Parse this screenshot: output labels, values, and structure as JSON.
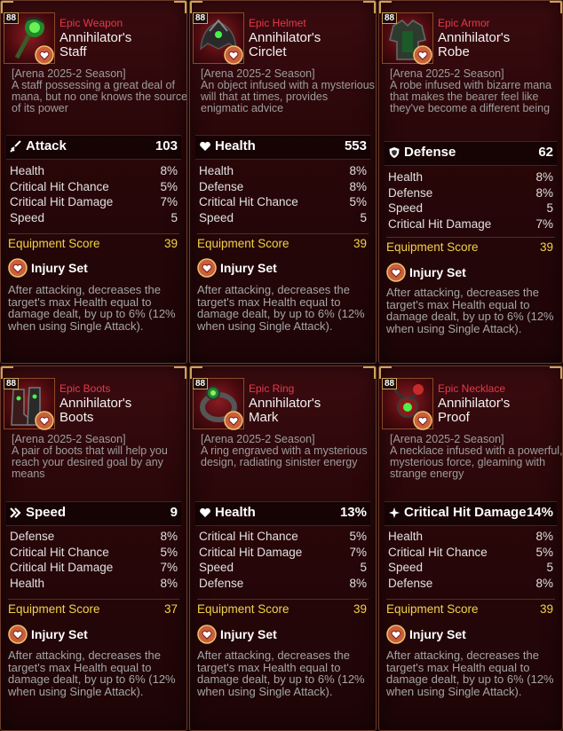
{
  "colors": {
    "rarity": "#e8384b",
    "score": "#f2d24a",
    "frame": "#c9a45a"
  },
  "items": [
    {
      "level": "88",
      "rarity": "Epic Weapon",
      "name_line1": "Annihilator's",
      "name_line2": "Staff",
      "icon": "staff-icon",
      "season": "[Arena 2025-2 Season]",
      "desc": "A staff possessing a great deal of mana, but no one knows the source of its power",
      "main": {
        "icon": "sword-icon",
        "label": "Attack",
        "value": "103"
      },
      "subs": [
        {
          "label": "Health",
          "value": "8%"
        },
        {
          "label": "Critical Hit Chance",
          "value": "5%"
        },
        {
          "label": "Critical Hit Damage",
          "value": "7%"
        },
        {
          "label": "Speed",
          "value": "5"
        }
      ],
      "score_label": "Equipment Score",
      "score": "39",
      "set_name": "Injury Set",
      "set_desc": "After attacking, decreases the target's max Health equal to damage dealt, by up to 6% (12% when using Single Attack)."
    },
    {
      "level": "88",
      "rarity": "Epic Helmet",
      "name_line1": "Annihilator's",
      "name_line2": "Circlet",
      "icon": "helmet-icon",
      "season": "[Arena 2025-2 Season]",
      "desc": "An object infused with a mysterious will that at times, provides enigmatic advice",
      "main": {
        "icon": "heart-icon",
        "label": "Health",
        "value": "553"
      },
      "subs": [
        {
          "label": "Health",
          "value": "8%"
        },
        {
          "label": "Defense",
          "value": "8%"
        },
        {
          "label": "Critical Hit Chance",
          "value": "5%"
        },
        {
          "label": "Speed",
          "value": "5"
        }
      ],
      "score_label": "Equipment Score",
      "score": "39",
      "set_name": "Injury Set",
      "set_desc": "After attacking, decreases the target's max Health equal to damage dealt, by up to 6% (12% when using Single Attack)."
    },
    {
      "level": "88",
      "rarity": "Epic Armor",
      "name_line1": "Annihilator's",
      "name_line2": "Robe",
      "icon": "armor-icon",
      "season": "[Arena 2025-2 Season]",
      "desc": "A robe infused with bizarre mana that makes the bearer feel like they've become a different being",
      "main": {
        "icon": "shield-icon",
        "label": "Defense",
        "value": "62"
      },
      "subs": [
        {
          "label": "Health",
          "value": "8%"
        },
        {
          "label": "Defense",
          "value": "8%"
        },
        {
          "label": "Speed",
          "value": "5"
        },
        {
          "label": "Critical Hit Damage",
          "value": "7%"
        }
      ],
      "score_label": "Equipment Score",
      "score": "39",
      "set_name": "Injury Set",
      "set_desc": "After attacking, decreases the target's max Health equal to damage dealt, by up to 6% (12% when using Single Attack)."
    },
    {
      "level": "88",
      "rarity": "Epic Boots",
      "name_line1": "Annihilator's",
      "name_line2": "Boots",
      "icon": "boots-icon",
      "season": "[Arena 2025-2 Season]",
      "desc": "A pair of boots that will help you reach your desired goal by any means",
      "main": {
        "icon": "speed-icon",
        "label": "Speed",
        "value": "9"
      },
      "subs": [
        {
          "label": "Defense",
          "value": "8%"
        },
        {
          "label": "Critical Hit Chance",
          "value": "5%"
        },
        {
          "label": "Critical Hit Damage",
          "value": "7%"
        },
        {
          "label": "Health",
          "value": "8%"
        }
      ],
      "score_label": "Equipment Score",
      "score": "37",
      "set_name": "Injury Set",
      "set_desc": "After attacking, decreases the target's max Health equal to damage dealt, by up to 6% (12% when using Single Attack)."
    },
    {
      "level": "88",
      "rarity": "Epic Ring",
      "name_line1": "Annihilator's",
      "name_line2": "Mark",
      "icon": "ring-icon",
      "season": "[Arena 2025-2 Season]",
      "desc": "A ring engraved with a mysterious design, radiating sinister energy",
      "main": {
        "icon": "heart-icon",
        "label": "Health",
        "value": "13%"
      },
      "subs": [
        {
          "label": "Critical Hit Chance",
          "value": "5%"
        },
        {
          "label": "Critical Hit Damage",
          "value": "7%"
        },
        {
          "label": "Speed",
          "value": "5"
        },
        {
          "label": "Defense",
          "value": "8%"
        }
      ],
      "score_label": "Equipment Score",
      "score": "39",
      "set_name": "Injury Set",
      "set_desc": "After attacking, decreases the target's max Health equal to damage dealt, by up to 6% (12% when using Single Attack)."
    },
    {
      "level": "88",
      "rarity": "Epic Necklace",
      "name_line1": "Annihilator's",
      "name_line2": "Proof",
      "icon": "necklace-icon",
      "season": "[Arena 2025-2 Season]",
      "desc": "A necklace infused with a powerful, mysterious force, gleaming with strange energy",
      "main": {
        "icon": "crit-damage-icon",
        "label": "Critical Hit Damage",
        "value": "14%"
      },
      "subs": [
        {
          "label": "Health",
          "value": "8%"
        },
        {
          "label": "Critical Hit Chance",
          "value": "5%"
        },
        {
          "label": "Speed",
          "value": "5"
        },
        {
          "label": "Defense",
          "value": "8%"
        }
      ],
      "score_label": "Equipment Score",
      "score": "39",
      "set_name": "Injury Set",
      "set_desc": "After attacking, decreases the target's max Health equal to damage dealt, by up to 6% (12% when using Single Attack)."
    }
  ]
}
